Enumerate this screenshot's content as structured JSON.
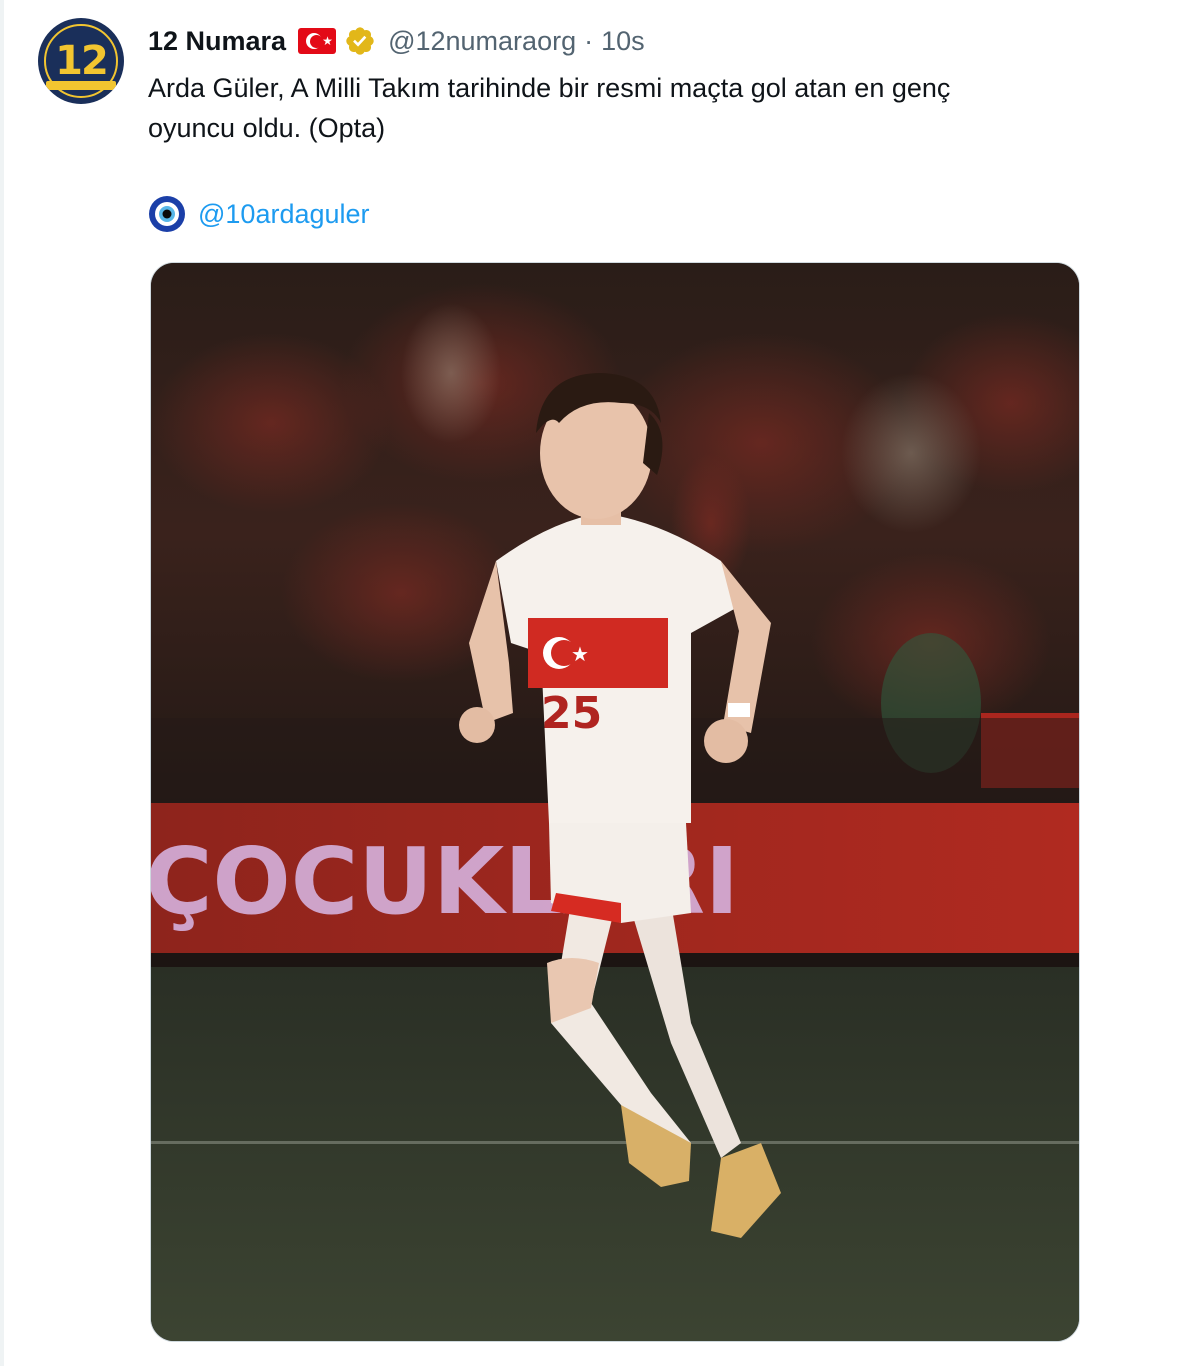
{
  "tweet": {
    "author_name": "12 Numara",
    "handle": "@12numaraorg",
    "separator": "·",
    "time": "10s",
    "text_line1": "Arda Güler, A Milli Takım tarihinde bir resmi maçta gol atan en genç",
    "text_line2": "oyuncu oldu. (Opta)",
    "mention": "@10ardaguler",
    "avatar_text": "12",
    "flag_icon": "turkey-flag-icon",
    "verified_icon": "verified-badge-icon",
    "mention_icon": "nazar-evil-eye-icon"
  },
  "photo": {
    "board_text": "ÇOCUKLARI",
    "shirt_number": "25",
    "subject": "football player in white Turkey kit running on pitch"
  },
  "colors": {
    "accent_link": "#1d9bf0",
    "secondary_text": "#536471",
    "verified_gold": "#e2b719",
    "flag_red": "#e30a17"
  }
}
